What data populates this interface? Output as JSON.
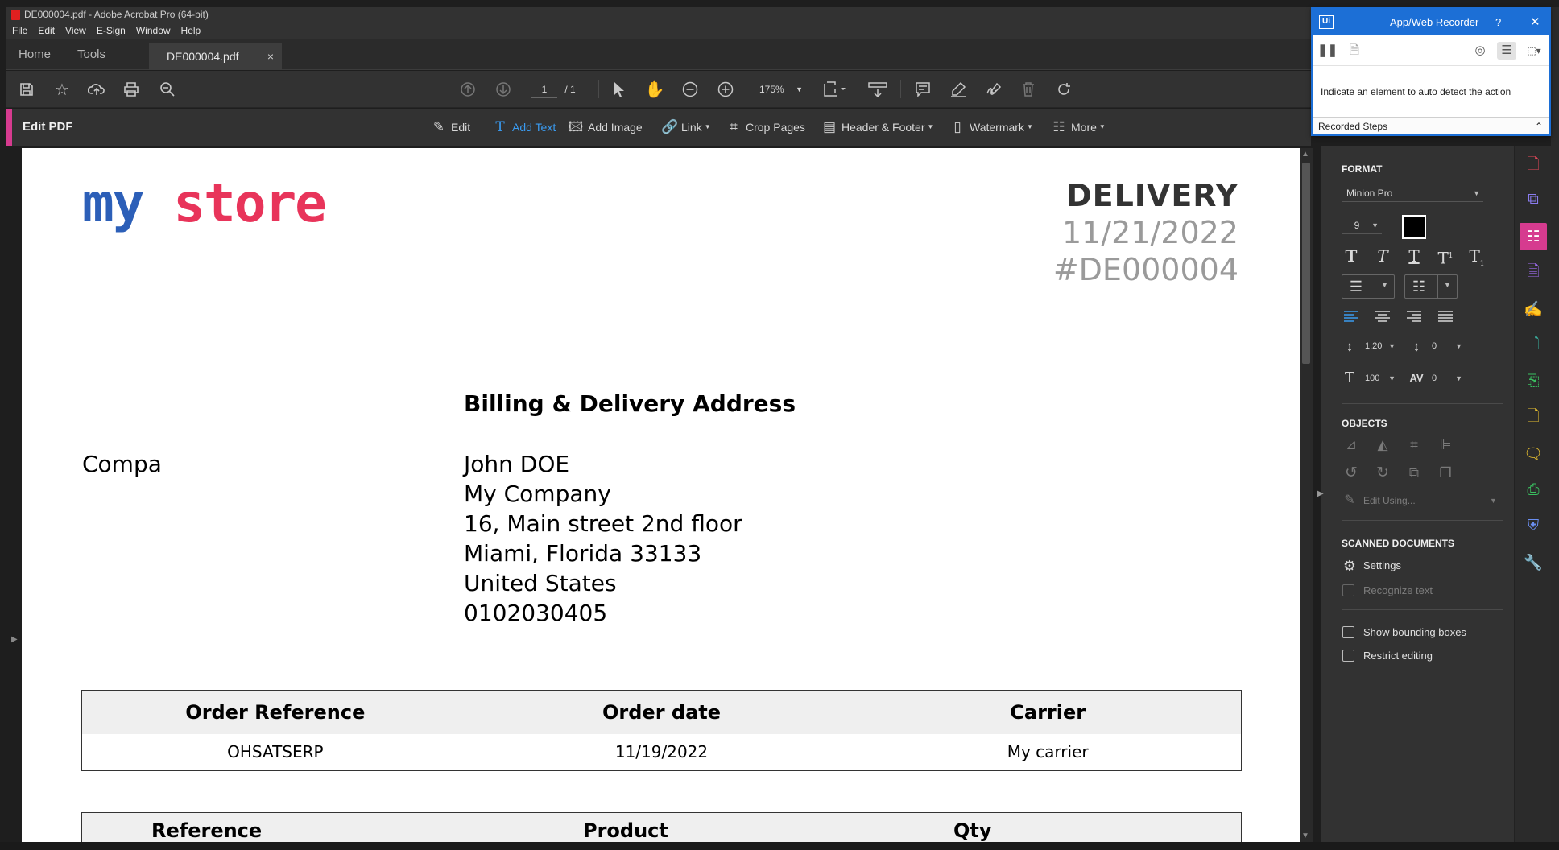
{
  "window": {
    "title": "DE000004.pdf - Adobe Acrobat Pro (64-bit)"
  },
  "menu": [
    "File",
    "Edit",
    "View",
    "E-Sign",
    "Window",
    "Help"
  ],
  "tabs": {
    "home": "Home",
    "tools": "Tools",
    "document": "DE000004.pdf",
    "close": "×"
  },
  "toolbar": {
    "page_current": "1",
    "page_total": "/ 1",
    "zoom": "175%"
  },
  "edit_bar": {
    "title": "Edit PDF",
    "items": [
      "Edit",
      "Add Text",
      "Add Image",
      "Link",
      "Crop Pages",
      "Header & Footer",
      "Watermark",
      "More"
    ],
    "active": "Add Text"
  },
  "document": {
    "logo": {
      "my": "my",
      "store": "store"
    },
    "heading": "DELIVERY",
    "date": "11/21/2022",
    "number": "#DE000004",
    "address_title": "Billing & Delivery Address",
    "left_text": "Compa",
    "address": [
      "John DOE",
      "My Company",
      "16, Main street 2nd floor",
      "Miami, Florida 33133",
      "United States",
      "0102030405"
    ],
    "order_table": {
      "headers": [
        "Order Reference",
        "Order date",
        "Carrier"
      ],
      "row": [
        "OHSATSERP",
        "11/19/2022",
        "My carrier"
      ]
    },
    "product_table": {
      "headers": [
        "Reference",
        "Product",
        "Qty"
      ]
    }
  },
  "recorder": {
    "title": "App/Web Recorder",
    "help": "?",
    "close": "✕",
    "hint": "Indicate an element to auto detect the action",
    "steps_label": "Recorded Steps"
  },
  "format_panel": {
    "format_title": "FORMAT",
    "font_name": "Minion Pro",
    "font_size": "9",
    "line_spacing": "1.20",
    "para_spacing": "0",
    "scale": "100",
    "char_spacing": "0",
    "text_color": "#000000",
    "objects_title": "OBJECTS",
    "edit_using": "Edit Using...",
    "scanned_title": "SCANNED DOCUMENTS",
    "settings": "Settings",
    "recognize_text": "Recognize text",
    "show_bounding_boxes": "Show bounding boxes",
    "restrict_editing": "Restrict editing"
  },
  "colors": {
    "accent": "#d63b8f",
    "link_blue": "#3a9bf0",
    "recorder_blue": "#1c6fd6"
  }
}
